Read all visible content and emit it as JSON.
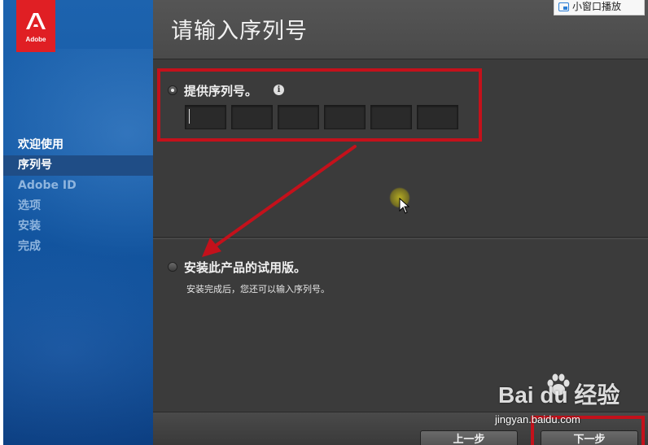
{
  "app": {
    "logo_text": "Adobe"
  },
  "sidebar": {
    "steps": [
      {
        "label": "欢迎使用",
        "state": "done"
      },
      {
        "label": "序列号",
        "state": "active"
      },
      {
        "label": "Adobe ID",
        "state": "pending"
      },
      {
        "label": "选项",
        "state": "pending"
      },
      {
        "label": "安装",
        "state": "pending"
      },
      {
        "label": "完成",
        "state": "pending"
      }
    ]
  },
  "header": {
    "title": "请输入序列号"
  },
  "serial_option": {
    "label": "提供序列号。",
    "selected": true,
    "info_icon": "info-icon",
    "fields": [
      "",
      "",
      "",
      "",
      "",
      ""
    ]
  },
  "trial_option": {
    "label": "安装此产品的试用版。",
    "selected": false,
    "description": "安装完成后，您还可以输入序列号。"
  },
  "footer": {
    "back_label": "上一步",
    "next_label": "下一步"
  },
  "overlay": {
    "mini_player_label": "小窗口播放",
    "watermark_text": "Bai du 经验",
    "watermark_url": "jingyan.baidu.com",
    "annotation_color": "#c4111b"
  }
}
